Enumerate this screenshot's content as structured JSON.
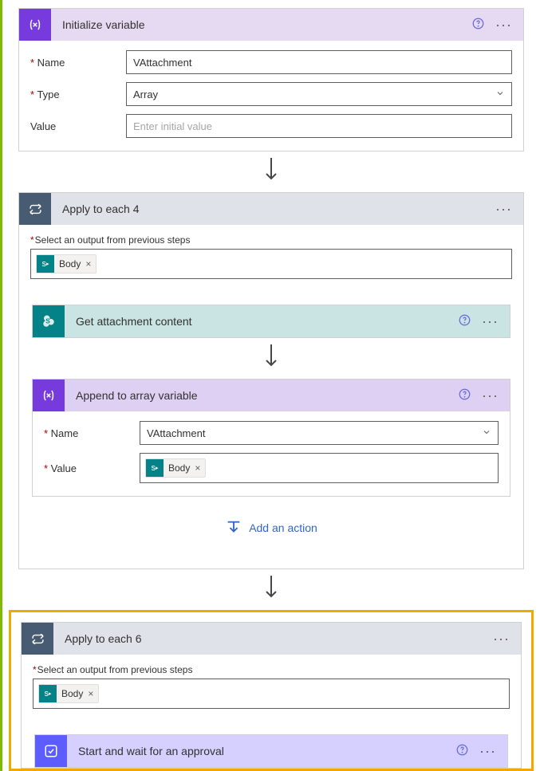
{
  "init_var": {
    "title": "Initialize variable",
    "name_label": "Name",
    "name_value": "VAttachment",
    "type_label": "Type",
    "type_value": "Array",
    "value_label": "Value",
    "value_placeholder": "Enter initial value"
  },
  "apply4": {
    "title": "Apply to each 4",
    "select_label": "Select an output from previous steps",
    "token": "Body"
  },
  "get_attachment": {
    "title": "Get attachment content"
  },
  "append": {
    "title": "Append to array variable",
    "name_label": "Name",
    "name_value": "VAttachment",
    "value_label": "Value",
    "token": "Body"
  },
  "add_action": "Add an action",
  "apply6": {
    "title": "Apply to each 6",
    "select_label": "Select an output from previous steps",
    "token": "Body"
  },
  "approval": {
    "title": "Start and wait for an approval"
  }
}
